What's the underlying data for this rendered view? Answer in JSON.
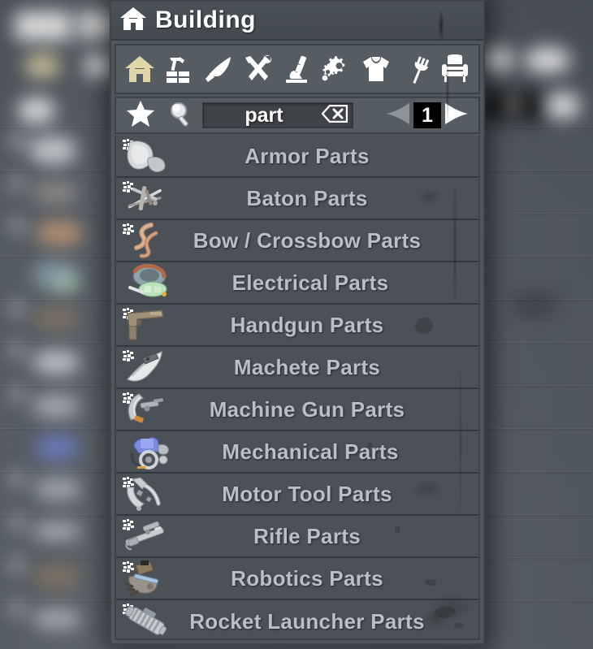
{
  "window": {
    "title": "Building",
    "title_icon": "house-icon"
  },
  "colors": {
    "panel_bg": "#4f565c",
    "row_bg": "#4b5156",
    "row_divider": "#31383e",
    "label_text": "#b9bfc4",
    "accent_selected": "#e3d5aa",
    "icon_white": "#ffffff",
    "page_box_bg": "#000000",
    "arrow_disabled": "#8d9499"
  },
  "toolbar": {
    "categories": [
      {
        "name": "building",
        "icon": "house-icon",
        "selected": true
      },
      {
        "name": "construction",
        "icon": "hammer-bricks-icon",
        "selected": false
      },
      {
        "name": "weapons",
        "icon": "knife-blade-icon",
        "selected": false
      },
      {
        "name": "tools",
        "icon": "crossed-tools-icon",
        "selected": false
      },
      {
        "name": "chemistry",
        "icon": "microscope-icon",
        "selected": false
      },
      {
        "name": "parts",
        "icon": "gears-icon",
        "selected": false
      },
      {
        "name": "clothing",
        "icon": "shirt-icon",
        "selected": false
      },
      {
        "name": "food",
        "icon": "fork-icon",
        "selected": false
      },
      {
        "name": "decor",
        "icon": "chair-icon",
        "selected": false
      }
    ]
  },
  "search": {
    "favorites_icon": "star-icon",
    "search_icon": "magnifier-icon",
    "value": "part",
    "placeholder": "",
    "clear_icon": "backspace-delete-icon"
  },
  "pagination": {
    "prev_icon": "triangle-left-icon",
    "prev_enabled": false,
    "page": "1",
    "next_icon": "triangle-right-icon",
    "next_enabled": true
  },
  "list": {
    "rows": [
      {
        "label": "Armor Parts",
        "icon": "armor-plate-thumb",
        "badge": true
      },
      {
        "label": "Baton Parts",
        "icon": "baton-rods-thumb",
        "badge": true
      },
      {
        "label": "Bow / Crossbow Parts",
        "icon": "bow-limbs-thumb",
        "badge": true
      },
      {
        "label": "Electrical Parts",
        "icon": "electrical-coil-thumb",
        "badge": false
      },
      {
        "label": "Handgun Parts",
        "icon": "handgun-frame-thumb",
        "badge": true
      },
      {
        "label": "Machete Parts",
        "icon": "machete-blade-thumb",
        "badge": true
      },
      {
        "label": "Machine Gun Parts",
        "icon": "machinegun-thumb",
        "badge": true
      },
      {
        "label": "Mechanical Parts",
        "icon": "mechanical-motor-thumb",
        "badge": false
      },
      {
        "label": "Motor Tool Parts",
        "icon": "motortool-chain-thumb",
        "badge": true
      },
      {
        "label": "Rifle Parts",
        "icon": "rifle-receiver-thumb",
        "badge": true
      },
      {
        "label": "Robotics Parts",
        "icon": "robotics-turret-thumb",
        "badge": true
      },
      {
        "label": "Rocket Launcher Parts",
        "icon": "rocket-tube-thumb",
        "badge": true
      }
    ],
    "badge_icon": "craft-station-badge-icon"
  }
}
